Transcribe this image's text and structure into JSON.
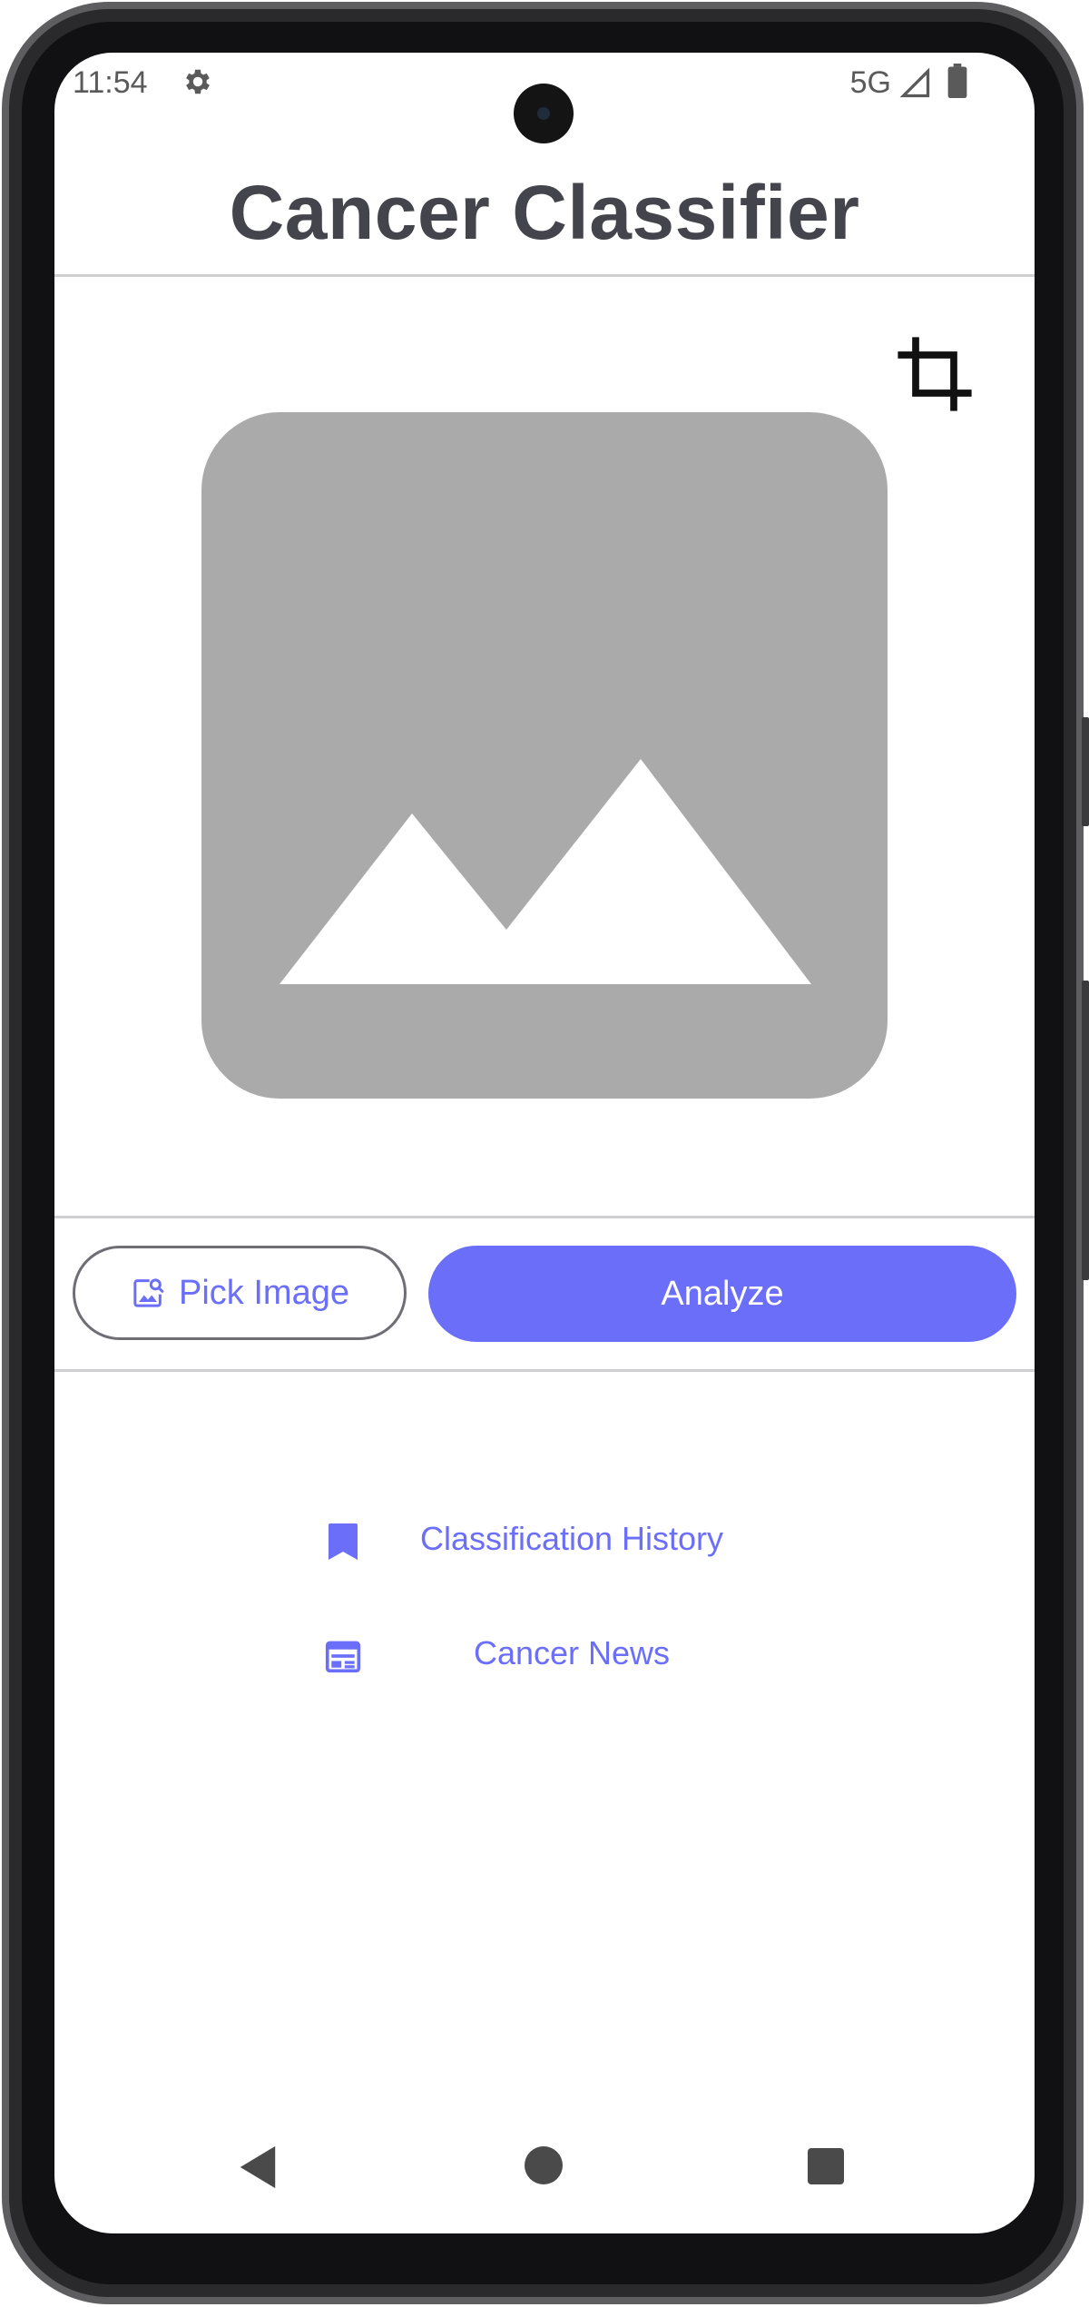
{
  "status_bar": {
    "time": "11:54",
    "network": "5G",
    "icons": [
      "gear-icon",
      "signal-icon",
      "battery-icon"
    ]
  },
  "app": {
    "title": "Cancer Classifier",
    "accent_color": "#6a6ef8",
    "title_color": "#44444c"
  },
  "image_area": {
    "crop_icon": "crop-icon",
    "placeholder_icon": "image-placeholder-icon"
  },
  "actions": {
    "pick_image_label": "Pick Image",
    "pick_image_icon": "image-search-icon",
    "analyze_label": "Analyze"
  },
  "links": [
    {
      "label": "Classification History",
      "icon": "bookmark-icon"
    },
    {
      "label": "Cancer News",
      "icon": "newspaper-icon"
    }
  ],
  "nav_bar": {
    "icons": [
      "back-icon",
      "home-icon",
      "recents-icon"
    ]
  }
}
